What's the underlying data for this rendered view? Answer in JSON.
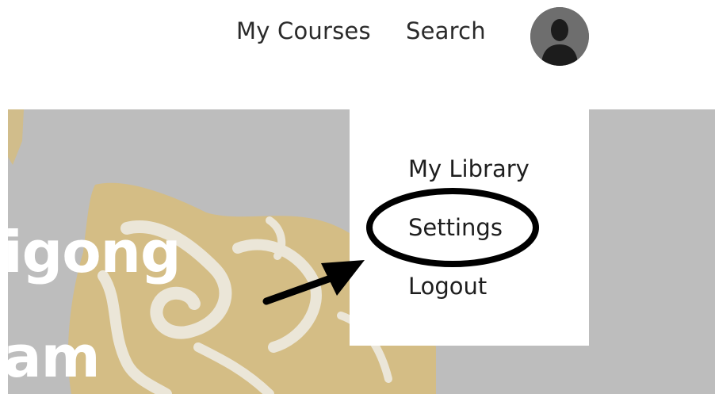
{
  "nav": {
    "links": [
      "My Courses",
      "Search"
    ],
    "avatar_icon": "user-silhouette-icon"
  },
  "hero": {
    "title_line1": "igong",
    "title_line2": "am",
    "background_color": "#bdbdbd",
    "art_color": "#d6bd7e"
  },
  "dropdown": {
    "items": [
      "My Library",
      "Settings",
      "Logout"
    ]
  },
  "annotation": {
    "arrow_icon": "arrow-icon",
    "highlight_icon": "circle-highlight-icon",
    "color": "#000000"
  }
}
